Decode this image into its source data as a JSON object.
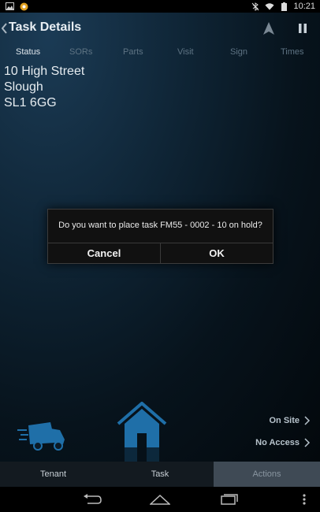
{
  "status_bar": {
    "time": "10:21",
    "battery_icon": "battery-icon",
    "wifi_icon": "wifi-icon",
    "bluetooth_icon": "bluetooth-off-icon",
    "notification_icons": [
      "image-notification-icon",
      "app-notification-icon"
    ]
  },
  "header": {
    "title": "Task Details",
    "back_icon": "chevron-left-icon",
    "nav_icon": "navigation-arrow-icon",
    "pause_icon": "pause-icon"
  },
  "tabs": [
    {
      "label": "Status",
      "active": true
    },
    {
      "label": "SORs",
      "active": false
    },
    {
      "label": "Parts",
      "active": false
    },
    {
      "label": "Visit",
      "active": false
    },
    {
      "label": "Sign",
      "active": false
    },
    {
      "label": "Times",
      "active": false
    }
  ],
  "address": {
    "line1": "10 High Street",
    "line2": "Slough",
    "line3": "SL1 6GG"
  },
  "dialog": {
    "message": "Do you want to place task FM55 - 0002 - 10 on hold?",
    "cancel_label": "Cancel",
    "ok_label": "OK"
  },
  "actions": {
    "on_site_label": "On Site",
    "no_access_label": "No Access",
    "truck_icon": "delivery-truck-icon",
    "house_icon": "house-icon"
  },
  "bottom_tabs": [
    {
      "label": "Tenant",
      "active": false
    },
    {
      "label": "Task",
      "active": false
    },
    {
      "label": "Actions",
      "active": true
    }
  ],
  "colors": {
    "accent_blue": "#1f6fa8",
    "background_dark": "#0f2536"
  }
}
